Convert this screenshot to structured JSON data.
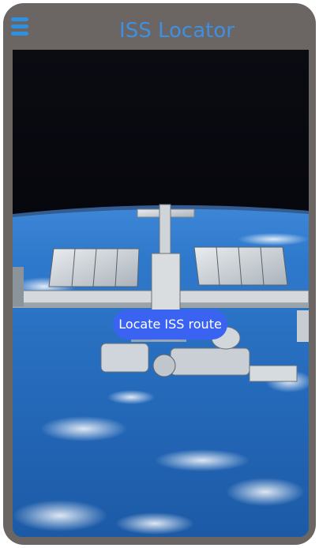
{
  "app": {
    "title": "ISS Locator"
  },
  "actions": {
    "locate_label": "Locate ISS route"
  },
  "icons": {
    "menu": "hamburger-menu-icon"
  },
  "colors": {
    "title": "#3f8fe2",
    "menu_icon": "#2f8fe0",
    "button_bg": "#3a63f2",
    "button_text": "#ffffff",
    "frame": "#6b6564"
  }
}
